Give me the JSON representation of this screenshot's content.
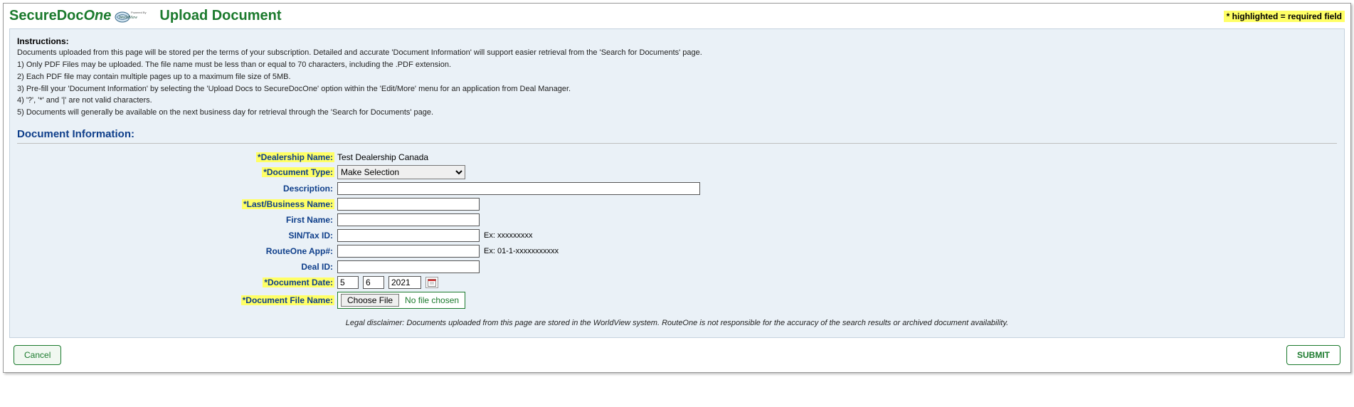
{
  "header": {
    "brand_prefix": "SecureDoc",
    "brand_suffix": "One",
    "logo_text": "WorldView",
    "page_title": "Upload Document",
    "required_note": "* highlighted = required field"
  },
  "instructions": {
    "title": "Instructions:",
    "intro": "Documents uploaded from this page will be stored per the terms of your subscription. Detailed and accurate 'Document Information' will support easier retrieval from the 'Search for Documents' page.",
    "lines": [
      "1) Only PDF Files may be uploaded. The file name must be less than or equal to 70 characters, including the .PDF extension.",
      "2) Each PDF file may contain multiple pages up to a maximum file size of 5MB.",
      "3) Pre-fill your 'Document Information' by selecting the 'Upload Docs to SecureDocOne' option within the 'Edit/More' menu for an application from Deal Manager.",
      "4) '?', '*' and '|' are not valid characters.",
      "5) Documents will generally be available on the next business day for retrieval through the 'Search for Documents' page."
    ]
  },
  "section_title": "Document Information:",
  "labels": {
    "dealership_name": "*Dealership Name:",
    "document_type": "*Document Type:",
    "description": "Description:",
    "last_business": "*Last/Business Name:",
    "first_name": "First Name:",
    "sin_tax": "SIN/Tax ID:",
    "routeone_app": "RouteOne App#:",
    "deal_id": "Deal ID:",
    "document_date": "*Document Date:",
    "document_file": "*Document File Name:"
  },
  "values": {
    "dealership_name": "Test Dealership Canada",
    "document_type_selected": "Make Selection",
    "description": "",
    "last_business": "",
    "first_name": "",
    "sin_tax": "",
    "routeone_app": "",
    "deal_id": "",
    "date_day": "5",
    "date_month": "6",
    "date_year": "2021",
    "file_status": "No file chosen",
    "choose_file_label": "Choose File"
  },
  "hints": {
    "sin_tax": "Ex: xxxxxxxxx",
    "routeone_app": "Ex: 01-1-xxxxxxxxxxx"
  },
  "disclaimer": "Legal disclaimer: Documents uploaded from this page are stored in the WorldView system. RouteOne is not responsible for the accuracy of the search results or archived document availability.",
  "buttons": {
    "cancel": "Cancel",
    "submit": "SUBMIT"
  }
}
